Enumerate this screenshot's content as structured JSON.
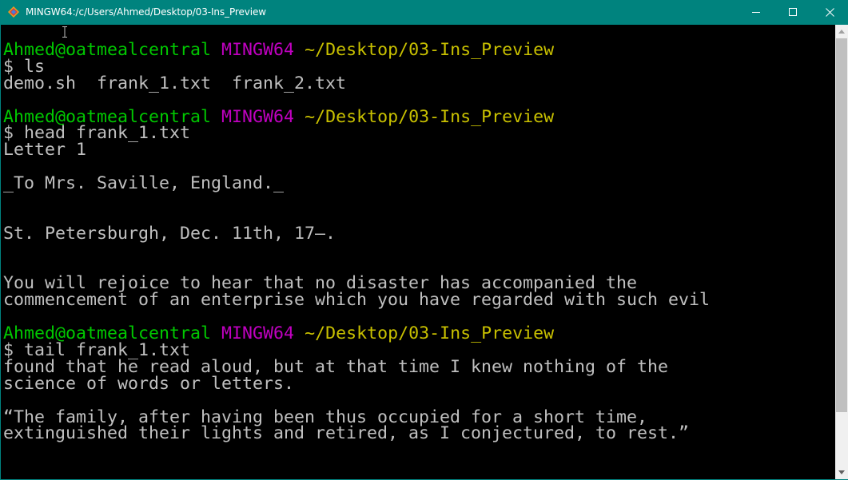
{
  "window": {
    "title": "MINGW64:/c/Users/Ahmed/Desktop/03-Ins_Preview",
    "controls": {
      "minimize_icon": "minimize-icon",
      "maximize_icon": "maximize-icon",
      "close_icon": "close-icon"
    }
  },
  "colors": {
    "titlebar": "#00837e",
    "user": "#00c800",
    "host": "#c000c0",
    "path": "#c8c000",
    "text": "#c0c0c0",
    "background": "#000000"
  },
  "terminal": {
    "prompt_user": "Ahmed@oatmealcentral",
    "prompt_host": "MINGW64",
    "prompt_path": "~/Desktop/03-Ins_Preview",
    "blocks": [
      {
        "command": "$ ls",
        "output": [
          "demo.sh  frank_1.txt  frank_2.txt",
          ""
        ]
      },
      {
        "command": "$ head frank_1.txt",
        "output": [
          "Letter 1",
          "",
          "_To Mrs. Saville, England._",
          "",
          "",
          "St. Petersburgh, Dec. 11th, 17—.",
          "",
          "",
          "You will rejoice to hear that no disaster has accompanied the",
          "commencement of an enterprise which you have regarded with such evil",
          ""
        ]
      },
      {
        "command": "$ tail frank_1.txt",
        "output": [
          "found that he read aloud, but at that time I knew nothing of the",
          "science of words or letters.",
          "",
          "“The family, after having been thus occupied for a short time,",
          "extinguished their lights and retired, as I conjectured, to rest.”"
        ]
      }
    ]
  }
}
